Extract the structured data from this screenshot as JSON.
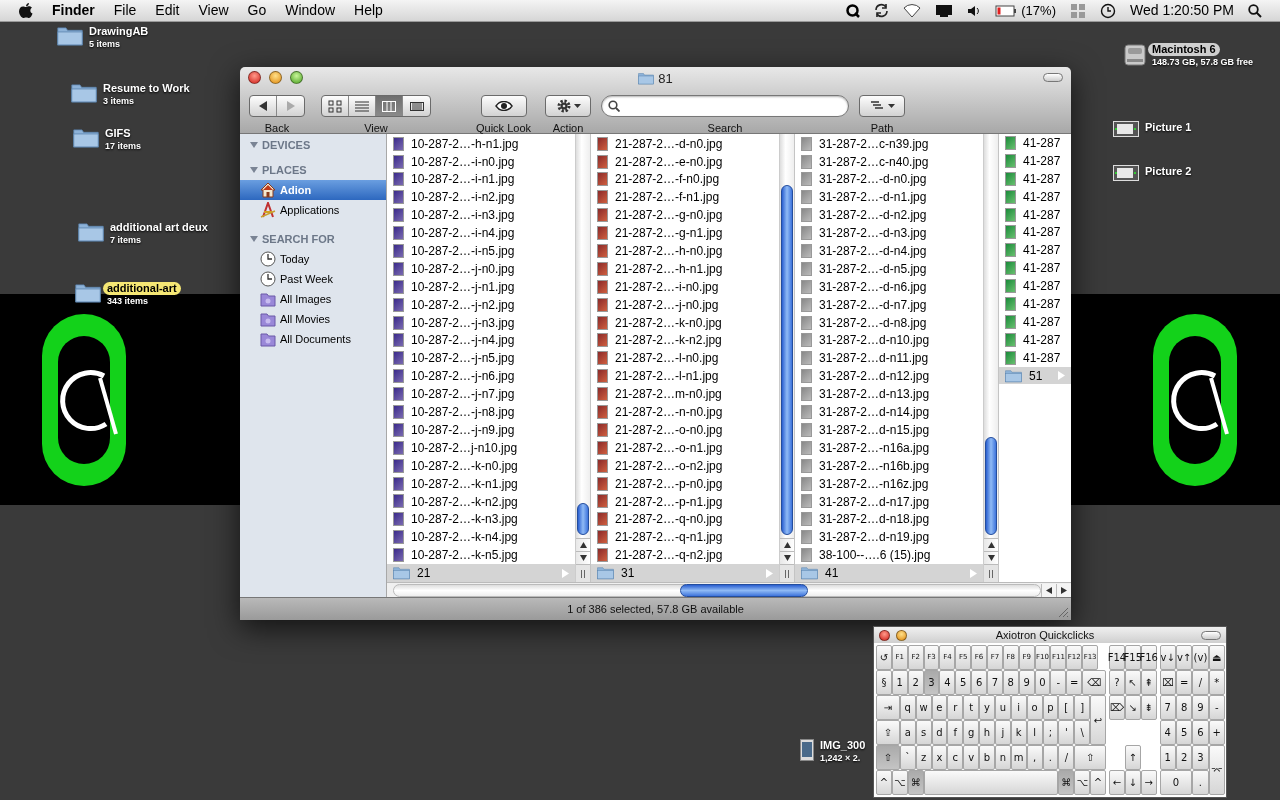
{
  "menu_bar": {
    "app": "Finder",
    "menus": [
      "File",
      "Edit",
      "View",
      "Go",
      "Window",
      "Help"
    ],
    "battery": "(17%)",
    "clock": "Wed 1:20:50 PM"
  },
  "desktop_icons": [
    {
      "kind": "folder",
      "name": "DrawingAB",
      "info": "5 items"
    },
    {
      "kind": "folder",
      "name": "Resume to Work",
      "info": "3 items"
    },
    {
      "kind": "folder",
      "name": "GIFS",
      "info": "17 items"
    },
    {
      "kind": "folder",
      "name": "additional art deux",
      "info": "7 items"
    },
    {
      "kind": "folder",
      "name": "additional-art",
      "info": "343 items",
      "color": "#f5e774"
    },
    {
      "kind": "drive",
      "name": "Macintosh 6",
      "info": "148.73 GB, 57.8 GB free",
      "color": "#cfcfcf"
    },
    {
      "kind": "screenshot",
      "name": "Picture 1"
    },
    {
      "kind": "screenshot",
      "name": "Picture 2"
    },
    {
      "kind": "image",
      "name": "IMG_300",
      "info": "1,242 × 2."
    }
  ],
  "finder": {
    "title": "81",
    "toolbar": [
      {
        "kind": "history",
        "label": "Back",
        "buttons": [
          {
            "disabled": false
          },
          {
            "disabled": true
          }
        ]
      },
      {
        "kind": "views",
        "label": "View",
        "views": [
          {
            "selected": false
          },
          {
            "selected": false
          },
          {
            "selected": true
          },
          {
            "selected": false
          }
        ]
      },
      {
        "kind": "quicklook",
        "label": "Quick Look"
      },
      {
        "kind": "action",
        "label": "Action"
      },
      {
        "kind": "search",
        "label": "Search"
      },
      {
        "kind": "path",
        "label": "Path"
      }
    ],
    "sidebar": [
      {
        "heading": "DEVICES",
        "expanded": true
      },
      {
        "heading": "PLACES",
        "expanded": true,
        "items": [
          {
            "kind": "home",
            "label": "Adion",
            "selected": true
          },
          {
            "kind": "apps",
            "label": "Applications",
            "selected": false
          }
        ]
      },
      {
        "heading": "SEARCH FOR",
        "expanded": true,
        "items": [
          {
            "kind": "clock",
            "label": "Today",
            "selected": false
          },
          {
            "kind": "clock",
            "label": "Past Week",
            "selected": false
          },
          {
            "kind": "smart",
            "label": "All Images",
            "selected": false
          },
          {
            "kind": "smart",
            "label": "All Movies",
            "selected": false
          },
          {
            "kind": "smart",
            "label": "All Documents",
            "selected": false
          }
        ]
      }
    ],
    "columns": [
      {
        "items": [
          {
            "kind": "file",
            "name": "10-287-2…-h-n1.jpg",
            "selected": false
          },
          {
            "kind": "file",
            "name": "10-287-2…-i-n0.jpg",
            "selected": false
          },
          {
            "kind": "file",
            "name": "10-287-2…-i-n1.jpg",
            "selected": false
          },
          {
            "kind": "file",
            "name": "10-287-2…-i-n2.jpg",
            "selected": false
          },
          {
            "kind": "file",
            "name": "10-287-2…-i-n3.jpg",
            "selected": false
          },
          {
            "kind": "file",
            "name": "10-287-2…-i-n4.jpg",
            "selected": false
          },
          {
            "kind": "file",
            "name": "10-287-2…-i-n5.jpg",
            "selected": false
          },
          {
            "kind": "file",
            "name": "10-287-2…-j-n0.jpg",
            "selected": false
          },
          {
            "kind": "file",
            "name": "10-287-2…-j-n1.jpg",
            "selected": false
          },
          {
            "kind": "file",
            "name": "10-287-2…-j-n2.jpg",
            "selected": false
          },
          {
            "kind": "file",
            "name": "10-287-2…-j-n3.jpg",
            "selected": false
          },
          {
            "kind": "file",
            "name": "10-287-2…-j-n4.jpg",
            "selected": false
          },
          {
            "kind": "file",
            "name": "10-287-2…-j-n5.jpg",
            "selected": false
          },
          {
            "kind": "file",
            "name": "10-287-2…-j-n6.jpg",
            "selected": false
          },
          {
            "kind": "file",
            "name": "10-287-2…-j-n7.jpg",
            "selected": false
          },
          {
            "kind": "file",
            "name": "10-287-2…-j-n8.jpg",
            "selected": false
          },
          {
            "kind": "file",
            "name": "10-287-2…-j-n9.jpg",
            "selected": false
          },
          {
            "kind": "file",
            "name": "10-287-2…j-n10.jpg",
            "selected": false
          },
          {
            "kind": "file",
            "name": "10-287-2…-k-n0.jpg",
            "selected": false
          },
          {
            "kind": "file",
            "name": "10-287-2…-k-n1.jpg",
            "selected": false
          },
          {
            "kind": "file",
            "name": "10-287-2…-k-n2.jpg",
            "selected": false
          },
          {
            "kind": "file",
            "name": "10-287-2…-k-n3.jpg",
            "selected": false
          },
          {
            "kind": "file",
            "name": "10-287-2…-k-n4.jpg",
            "selected": false
          },
          {
            "kind": "file",
            "name": "10-287-2…-k-n5.jpg",
            "selected": false
          },
          {
            "kind": "folder",
            "name": "21",
            "selected": true
          }
        ]
      },
      {
        "items": [
          {
            "kind": "file",
            "name": "21-287-2…-d-n0.jpg",
            "selected": false
          },
          {
            "kind": "file",
            "name": "21-287-2…-e-n0.jpg",
            "selected": false
          },
          {
            "kind": "file",
            "name": "21-287-2…-f-n0.jpg",
            "selected": false
          },
          {
            "kind": "file",
            "name": "21-287-2…-f-n1.jpg",
            "selected": false
          },
          {
            "kind": "file",
            "name": "21-287-2…-g-n0.jpg",
            "selected": false
          },
          {
            "kind": "file",
            "name": "21-287-2…-g-n1.jpg",
            "selected": false
          },
          {
            "kind": "file",
            "name": "21-287-2…-h-n0.jpg",
            "selected": false
          },
          {
            "kind": "file",
            "name": "21-287-2…-h-n1.jpg",
            "selected": false
          },
          {
            "kind": "file",
            "name": "21-287-2…-i-n0.jpg",
            "selected": false
          },
          {
            "kind": "file",
            "name": "21-287-2…-j-n0.jpg",
            "selected": false
          },
          {
            "kind": "file",
            "name": "21-287-2…-k-n0.jpg",
            "selected": false
          },
          {
            "kind": "file",
            "name": "21-287-2…-k-n2.jpg",
            "selected": false
          },
          {
            "kind": "file",
            "name": "21-287-2…-l-n0.jpg",
            "selected": false
          },
          {
            "kind": "file",
            "name": "21-287-2…-l-n1.jpg",
            "selected": false
          },
          {
            "kind": "file",
            "name": "21-287-2…m-n0.jpg",
            "selected": false
          },
          {
            "kind": "file",
            "name": "21-287-2…-n-n0.jpg",
            "selected": false
          },
          {
            "kind": "file",
            "name": "21-287-2…-o-n0.jpg",
            "selected": false
          },
          {
            "kind": "file",
            "name": "21-287-2…-o-n1.jpg",
            "selected": false
          },
          {
            "kind": "file",
            "name": "21-287-2…-o-n2.jpg",
            "selected": false
          },
          {
            "kind": "file",
            "name": "21-287-2…-p-n0.jpg",
            "selected": false
          },
          {
            "kind": "file",
            "name": "21-287-2…-p-n1.jpg",
            "selected": false
          },
          {
            "kind": "file",
            "name": "21-287-2…-q-n0.jpg",
            "selected": false
          },
          {
            "kind": "file",
            "name": "21-287-2…-q-n1.jpg",
            "selected": false
          },
          {
            "kind": "file",
            "name": "21-287-2…-q-n2.jpg",
            "selected": false
          },
          {
            "kind": "folder",
            "name": "31",
            "selected": true
          }
        ]
      },
      {
        "items": [
          {
            "kind": "file",
            "name": "31-287-2…c-n39.jpg",
            "selected": false
          },
          {
            "kind": "file",
            "name": "31-287-2…c-n40.jpg",
            "selected": false
          },
          {
            "kind": "file",
            "name": "31-287-2…-d-n0.jpg",
            "selected": false
          },
          {
            "kind": "file",
            "name": "31-287-2…-d-n1.jpg",
            "selected": false
          },
          {
            "kind": "file",
            "name": "31-287-2…-d-n2.jpg",
            "selected": false
          },
          {
            "kind": "file",
            "name": "31-287-2…-d-n3.jpg",
            "selected": false
          },
          {
            "kind": "file",
            "name": "31-287-2…-d-n4.jpg",
            "selected": false
          },
          {
            "kind": "file",
            "name": "31-287-2…-d-n5.jpg",
            "selected": false
          },
          {
            "kind": "file",
            "name": "31-287-2…-d-n6.jpg",
            "selected": false
          },
          {
            "kind": "file",
            "name": "31-287-2…-d-n7.jpg",
            "selected": false
          },
          {
            "kind": "file",
            "name": "31-287-2…-d-n8.jpg",
            "selected": false
          },
          {
            "kind": "file",
            "name": "31-287-2…d-n10.jpg",
            "selected": false
          },
          {
            "kind": "file",
            "name": "31-287-2…d-n11.jpg",
            "selected": false
          },
          {
            "kind": "file",
            "name": "31-287-2…d-n12.jpg",
            "selected": false
          },
          {
            "kind": "file",
            "name": "31-287-2…d-n13.jpg",
            "selected": false
          },
          {
            "kind": "file",
            "name": "31-287-2…d-n14.jpg",
            "selected": false
          },
          {
            "kind": "file",
            "name": "31-287-2…d-n15.jpg",
            "selected": false
          },
          {
            "kind": "file",
            "name": "31-287-2…-n16a.jpg",
            "selected": false
          },
          {
            "kind": "file",
            "name": "31-287-2…-n16b.jpg",
            "selected": false
          },
          {
            "kind": "file",
            "name": "31-287-2…-n16z.jpg",
            "selected": false
          },
          {
            "kind": "file",
            "name": "31-287-2…d-n17.jpg",
            "selected": false
          },
          {
            "kind": "file",
            "name": "31-287-2…d-n18.jpg",
            "selected": false
          },
          {
            "kind": "file",
            "name": "31-287-2…d-n19.jpg",
            "selected": false
          },
          {
            "kind": "file",
            "name": "38-100--….6 (15).jpg",
            "selected": false
          },
          {
            "kind": "folder",
            "name": "41",
            "selected": true
          }
        ]
      },
      {
        "items": [
          {
            "kind": "file",
            "name": "41-287",
            "selected": false
          },
          {
            "kind": "file",
            "name": "41-287",
            "selected": false
          },
          {
            "kind": "file",
            "name": "41-287",
            "selected": false
          },
          {
            "kind": "file",
            "name": "41-287",
            "selected": false
          },
          {
            "kind": "file",
            "name": "41-287",
            "selected": false
          },
          {
            "kind": "file",
            "name": "41-287",
            "selected": false
          },
          {
            "kind": "file",
            "name": "41-287",
            "selected": false
          },
          {
            "kind": "file",
            "name": "41-287",
            "selected": false
          },
          {
            "kind": "file",
            "name": "41-287",
            "selected": false
          },
          {
            "kind": "file",
            "name": "41-287",
            "selected": false
          },
          {
            "kind": "file",
            "name": "41-287",
            "selected": false
          },
          {
            "kind": "file",
            "name": "41-287",
            "selected": false
          },
          {
            "kind": "file",
            "name": "41-287",
            "selected": false
          },
          {
            "kind": "folder",
            "name": "51",
            "selected": true
          }
        ]
      }
    ],
    "status": "1 of 386 selected, 57.8 GB available"
  },
  "keyboard": {
    "title": "Axiotron Quickclicks",
    "sections": [
      {
        "rows": [
          {
            "keys": [
              {
                "label": "↺",
                "kind": "single",
                "pressed": false
              },
              {
                "label": "F1",
                "kind": "single",
                "pressed": false
              },
              {
                "label": "F2",
                "kind": "single",
                "pressed": false
              },
              {
                "label": "F3",
                "kind": "single",
                "pressed": false
              },
              {
                "label": "F4",
                "kind": "single",
                "pressed": false
              },
              {
                "label": "F5",
                "kind": "single",
                "pressed": false
              },
              {
                "label": "F6",
                "kind": "single",
                "pressed": false
              },
              {
                "label": "F7",
                "kind": "single",
                "pressed": false
              },
              {
                "label": "F8",
                "kind": "single",
                "pressed": false
              },
              {
                "label": "F9",
                "kind": "single",
                "pressed": false
              },
              {
                "label": "F10",
                "kind": "single",
                "pressed": false
              },
              {
                "label": "F11",
                "kind": "single",
                "pressed": false
              },
              {
                "label": "F12",
                "kind": "single",
                "pressed": false
              },
              {
                "label": "F13",
                "kind": "single",
                "pressed": false
              }
            ]
          },
          {
            "keys": [
              {
                "label": "§",
                "kind": "single",
                "pressed": false
              },
              {
                "label": "1",
                "kind": "single",
                "pressed": false
              },
              {
                "label": "2",
                "kind": "single",
                "pressed": false
              },
              {
                "label": "3",
                "kind": "single",
                "pressed": true
              },
              {
                "label": "4",
                "kind": "single",
                "pressed": false
              },
              {
                "label": "5",
                "kind": "single",
                "pressed": false
              },
              {
                "label": "6",
                "kind": "single",
                "pressed": false
              },
              {
                "label": "7",
                "kind": "single",
                "pressed": false
              },
              {
                "label": "8",
                "kind": "single",
                "pressed": false
              },
              {
                "label": "9",
                "kind": "single",
                "pressed": false
              },
              {
                "label": "0",
                "kind": "single",
                "pressed": false
              },
              {
                "label": "-",
                "kind": "single",
                "pressed": false
              },
              {
                "label": "=",
                "kind": "single",
                "pressed": false
              },
              {
                "label": "⌫",
                "kind": "wide",
                "pressed": false
              }
            ]
          },
          {
            "keys": [
              {
                "label": "⇥",
                "kind": "wide",
                "pressed": false
              },
              {
                "label": "q",
                "kind": "single",
                "pressed": false
              },
              {
                "label": "w",
                "kind": "single",
                "pressed": false
              },
              {
                "label": "e",
                "kind": "single",
                "pressed": false
              },
              {
                "label": "r",
                "kind": "single",
                "pressed": false
              },
              {
                "label": "t",
                "kind": "single",
                "pressed": false
              },
              {
                "label": "y",
                "kind": "single",
                "pressed": false
              },
              {
                "label": "u",
                "kind": "single",
                "pressed": false
              },
              {
                "label": "i",
                "kind": "single",
                "pressed": false
              },
              {
                "label": "o",
                "kind": "single",
                "pressed": false
              },
              {
                "label": "p",
                "kind": "single",
                "pressed": false
              },
              {
                "label": "[",
                "kind": "single",
                "pressed": false
              },
              {
                "label": "]",
                "kind": "single",
                "pressed": false
              },
              {
                "label": "↩",
                "kind": "tall",
                "pressed": false
              }
            ]
          },
          {
            "keys": [
              {
                "label": "⇪",
                "kind": "wide",
                "pressed": false
              },
              {
                "label": "a",
                "kind": "single",
                "pressed": false
              },
              {
                "label": "s",
                "kind": "single",
                "pressed": false
              },
              {
                "label": "d",
                "kind": "single",
                "pressed": false
              },
              {
                "label": "f",
                "kind": "single",
                "pressed": false
              },
              {
                "label": "g",
                "kind": "single",
                "pressed": false
              },
              {
                "label": "h",
                "kind": "single",
                "pressed": false
              },
              {
                "label": "j",
                "kind": "single",
                "pressed": false
              },
              {
                "label": "k",
                "kind": "single",
                "pressed": false
              },
              {
                "label": "l",
                "kind": "single",
                "pressed": false
              },
              {
                "label": ";",
                "kind": "single",
                "pressed": false
              },
              {
                "label": "'",
                "kind": "single",
                "pressed": false
              },
              {
                "label": "\\",
                "kind": "single",
                "pressed": false
              }
            ]
          },
          {
            "keys": [
              {
                "label": "⇧",
                "kind": "wide",
                "pressed": true
              },
              {
                "label": "`",
                "kind": "single",
                "pressed": false
              },
              {
                "label": "z",
                "kind": "single",
                "pressed": false
              },
              {
                "label": "x",
                "kind": "single",
                "pressed": false
              },
              {
                "label": "c",
                "kind": "single",
                "pressed": false
              },
              {
                "label": "v",
                "kind": "single",
                "pressed": false
              },
              {
                "label": "b",
                "kind": "single",
                "pressed": false
              },
              {
                "label": "n",
                "kind": "single",
                "pressed": false
              },
              {
                "label": "m",
                "kind": "single",
                "pressed": false
              },
              {
                "label": ",",
                "kind": "single",
                "pressed": false
              },
              {
                "label": ".",
                "kind": "single",
                "pressed": false
              },
              {
                "label": "/",
                "kind": "single",
                "pressed": false
              },
              {
                "label": "⇧",
                "kind": "double",
                "pressed": false
              }
            ]
          },
          {
            "keys": [
              {
                "label": "^",
                "kind": "single",
                "pressed": false
              },
              {
                "label": "⌥",
                "kind": "single",
                "pressed": false
              },
              {
                "label": "⌘",
                "kind": "single",
                "pressed": true
              },
              {
                "kind": "space",
                "pressed": false
              },
              {
                "label": "⌘",
                "kind": "single",
                "pressed": true
              },
              {
                "label": "⌥",
                "kind": "single",
                "pressed": false
              },
              {
                "label": "^",
                "kind": "single",
                "pressed": false
              }
            ]
          }
        ]
      },
      {
        "rows": [
          {
            "keys": [
              {
                "label": "F14",
                "kind": "single",
                "pressed": false
              },
              {
                "label": "F15",
                "kind": "single",
                "pressed": false
              },
              {
                "label": "F16",
                "kind": "single",
                "pressed": false
              }
            ]
          },
          {
            "keys": [
              {
                "label": "?",
                "kind": "single",
                "pressed": false
              },
              {
                "label": "↖",
                "kind": "single",
                "pressed": false
              },
              {
                "label": "⇞",
                "kind": "single",
                "pressed": false
              }
            ]
          },
          {
            "keys": [
              {
                "label": "⌦",
                "kind": "single",
                "pressed": false
              },
              {
                "label": "↘",
                "kind": "single",
                "pressed": false
              },
              {
                "label": "⇟",
                "kind": "single",
                "pressed": false
              }
            ]
          },
          {
            "keys": [
              {
                "kind": "gap"
              },
              {
                "kind": "gap"
              },
              {
                "kind": "gap"
              }
            ]
          },
          {
            "keys": [
              {
                "kind": "gap"
              },
              {
                "label": "↑",
                "kind": "single",
                "pressed": false
              },
              {
                "kind": "gap"
              }
            ]
          },
          {
            "keys": [
              {
                "label": "←",
                "kind": "single",
                "pressed": false
              },
              {
                "label": "↓",
                "kind": "single",
                "pressed": false
              },
              {
                "label": "→",
                "kind": "single",
                "pressed": false
              }
            ]
          }
        ]
      },
      {
        "rows": [
          {
            "keys": [
              {
                "label": "v↓",
                "kind": "single",
                "pressed": false
              },
              {
                "label": "v↑",
                "kind": "single",
                "pressed": false
              },
              {
                "label": "(v)",
                "kind": "single",
                "pressed": false
              },
              {
                "label": "⏏",
                "kind": "single",
                "pressed": false
              }
            ]
          },
          {
            "keys": [
              {
                "label": "⌧",
                "kind": "single",
                "pressed": false
              },
              {
                "label": "=",
                "kind": "single",
                "pressed": false
              },
              {
                "label": "/",
                "kind": "single",
                "pressed": false
              },
              {
                "label": "*",
                "kind": "single",
                "pressed": false
              }
            ]
          },
          {
            "keys": [
              {
                "label": "7",
                "kind": "single",
                "pressed": false
              },
              {
                "label": "8",
                "kind": "single",
                "pressed": false
              },
              {
                "label": "9",
                "kind": "single",
                "pressed": false
              },
              {
                "label": "-",
                "kind": "single",
                "pressed": false
              }
            ]
          },
          {
            "keys": [
              {
                "label": "4",
                "kind": "single",
                "pressed": false
              },
              {
                "label": "5",
                "kind": "single",
                "pressed": false
              },
              {
                "label": "6",
                "kind": "single",
                "pressed": false
              },
              {
                "label": "+",
                "kind": "single",
                "pressed": false
              }
            ]
          },
          {
            "keys": [
              {
                "label": "1",
                "kind": "single",
                "pressed": false
              },
              {
                "label": "2",
                "kind": "single",
                "pressed": false
              },
              {
                "label": "3",
                "kind": "single",
                "pressed": false
              },
              {
                "label": "⌤",
                "kind": "tall",
                "pressed": false
              }
            ]
          },
          {
            "keys": [
              {
                "label": "0",
                "kind": "double",
                "pressed": false
              },
              {
                "label": ".",
                "kind": "single",
                "pressed": false
              }
            ]
          }
        ]
      }
    ]
  }
}
